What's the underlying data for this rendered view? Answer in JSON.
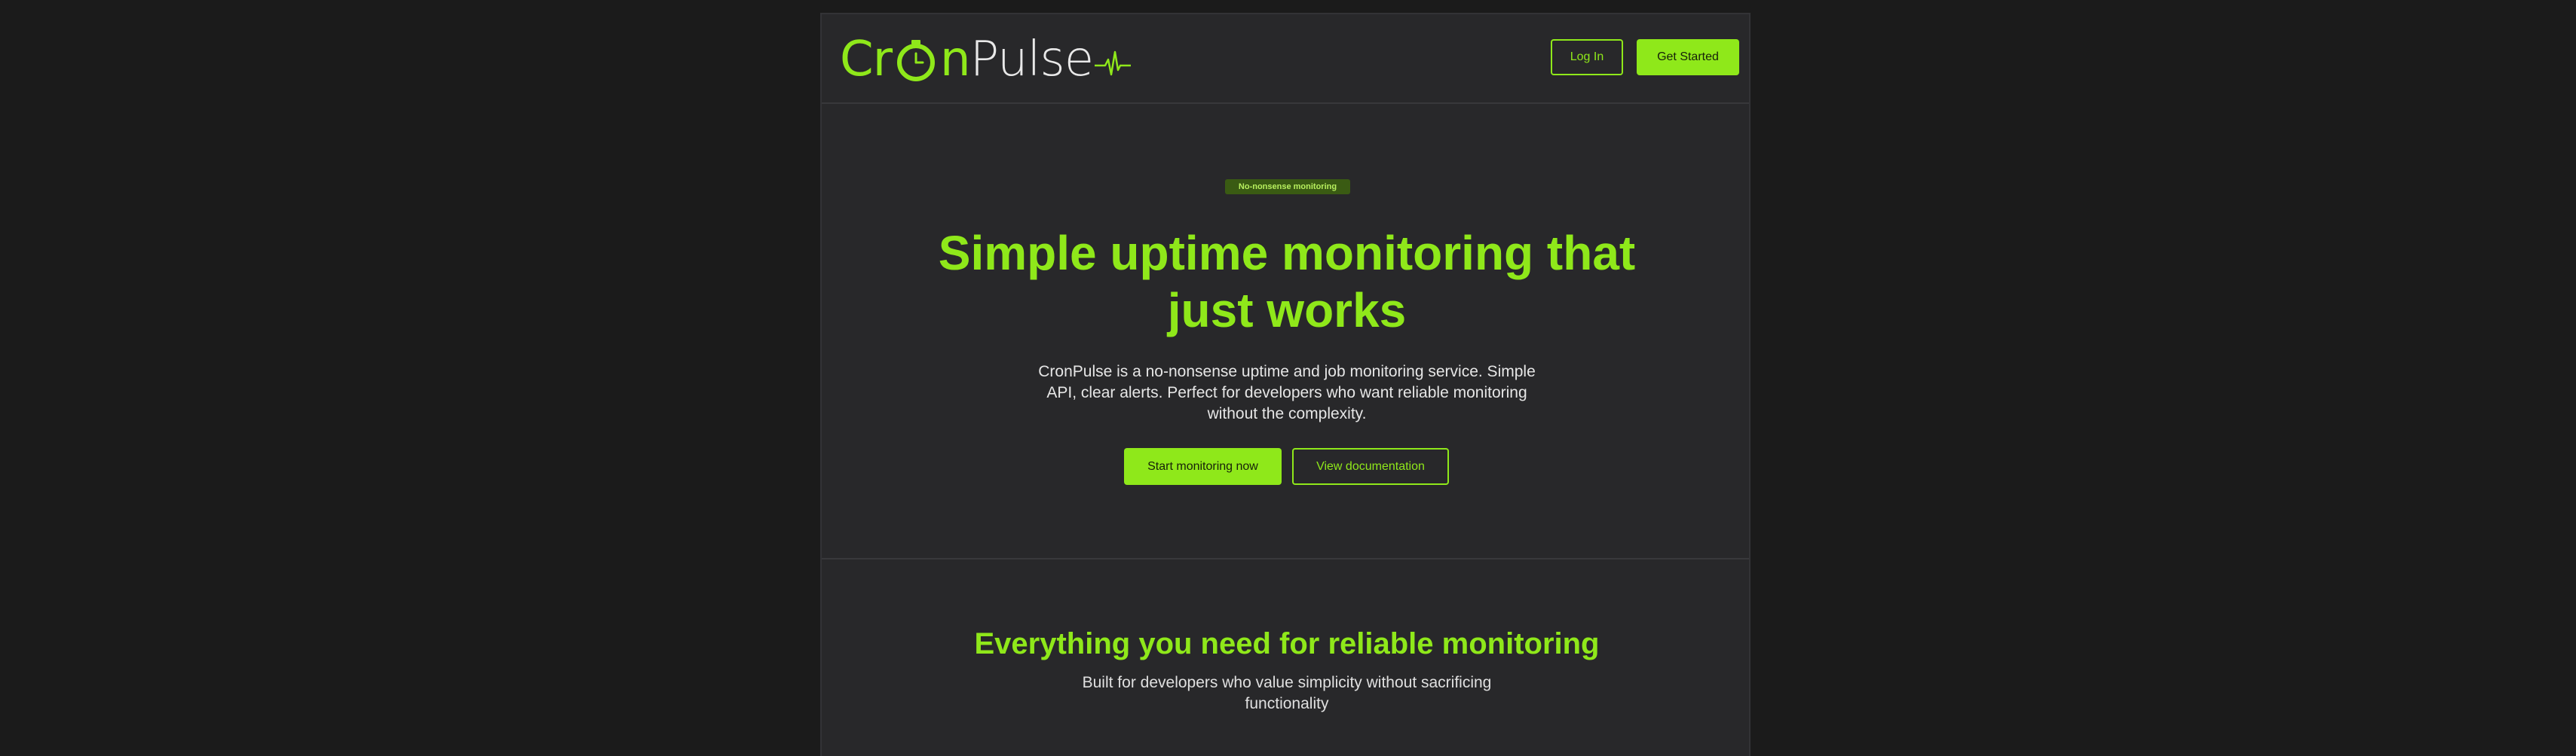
{
  "brand": {
    "name_part1": "Cr",
    "name_part2": "n",
    "name_part3": "Pulse",
    "accent_color": "#8fe81a",
    "background_color": "#28282a",
    "logo_icons": [
      "clock-icon",
      "heartbeat-icon"
    ]
  },
  "nav": {
    "login_label": "Log In",
    "get_started_label": "Get Started"
  },
  "hero": {
    "badge": "No-nonsense monitoring",
    "title": "Simple uptime monitoring that just works",
    "description": "CronPulse is a no-nonsense uptime and job monitoring service. Simple API, clear alerts. Perfect for developers who want reliable monitoring without the complexity.",
    "primary_cta": "Start monitoring now",
    "secondary_cta": "View documentation"
  },
  "features": {
    "title": "Everything you need for reliable monitoring",
    "subtitle": "Built for developers who value simplicity without sacrificing functionality"
  }
}
